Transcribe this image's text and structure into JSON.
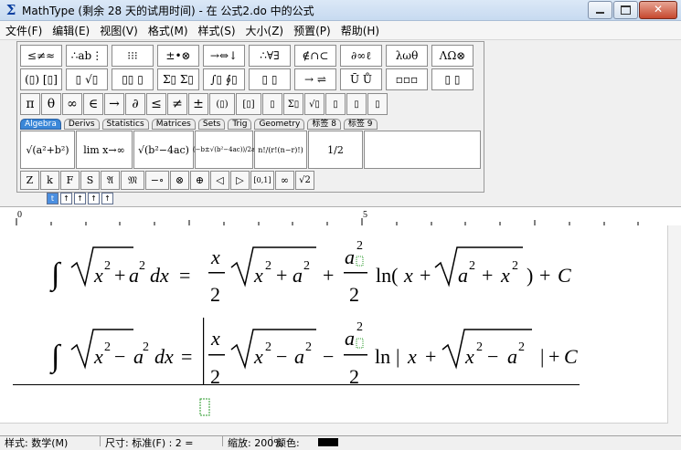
{
  "window": {
    "title": "MathType (剩余 28 天的试用时间) - 在 公式2.do 中的公式",
    "app_icon": "Σ",
    "close_glyph": "✕"
  },
  "menu": [
    "文件(F)",
    "编辑(E)",
    "视图(V)",
    "格式(M)",
    "样式(S)",
    "大小(Z)",
    "预置(P)",
    "帮助(H)"
  ],
  "palette": {
    "row1": [
      "≤≠≈",
      "∴ab⋮",
      "⁝⁝⁝",
      "±•⊗",
      "→⇔↓",
      "∴∀∃",
      "∉∩⊂",
      "∂∞ℓ",
      "λωθ",
      "ΛΩ⊗"
    ],
    "row2": [
      "(▯) [▯]",
      "▯ √▯",
      "▯▯ ▯",
      "Σ▯ Σ▯",
      "∫▯ ∮▯",
      "▯ ▯",
      "→ ⇌",
      "Ū Ů",
      "▫▫▫",
      "▯ ▯"
    ],
    "row3": [
      "π",
      "θ",
      "∞",
      "∈",
      "→",
      "∂",
      "≤",
      "≠",
      "±",
      "(▯)",
      "[▯]",
      "▯",
      "Σ▯",
      "√▯",
      "▯",
      "▯",
      "▯"
    ],
    "tabs": [
      "Algebra",
      "Derivs",
      "Statistics",
      "Matrices",
      "Sets",
      "Trig",
      "Geometry",
      "标签 8",
      "标签 9"
    ],
    "templates": [
      "√(a²+b²)",
      "lim x→∞",
      "√(b²−4ac)",
      "(−b±√(b²−4ac))/2a",
      "n!/(r!(n−r)!)",
      "1/2"
    ],
    "row5": [
      "Z",
      "k",
      "F",
      "S",
      "𝔄",
      "𝔐",
      "−∘",
      "⊗",
      "⊕",
      "◁",
      "▷",
      "[0,1]",
      "∞",
      "√2"
    ]
  },
  "small_buttons": [
    "t",
    "↑",
    "↑",
    "↑",
    "↑"
  ],
  "ruler": {
    "marks": [
      "0",
      "5"
    ]
  },
  "equations": [
    {
      "lhs": "∫√(x²+a²)dx",
      "rhs": "= x/2 √(x²+a²) + a²/2 ln(x + √(a²+x²)) + C"
    },
    {
      "lhs": "∫√(x²−a²)dx",
      "rhs": "= x/2 √(x²−a²) − a²/2 ln | x + √(x²−a²) | +C"
    }
  ],
  "status": {
    "style": "样式: 数学(M)",
    "size": "尺寸: 标准(F) : 2 =",
    "zoom": "缩放: 200%",
    "color_label": "颜色:",
    "color": "#000000"
  }
}
